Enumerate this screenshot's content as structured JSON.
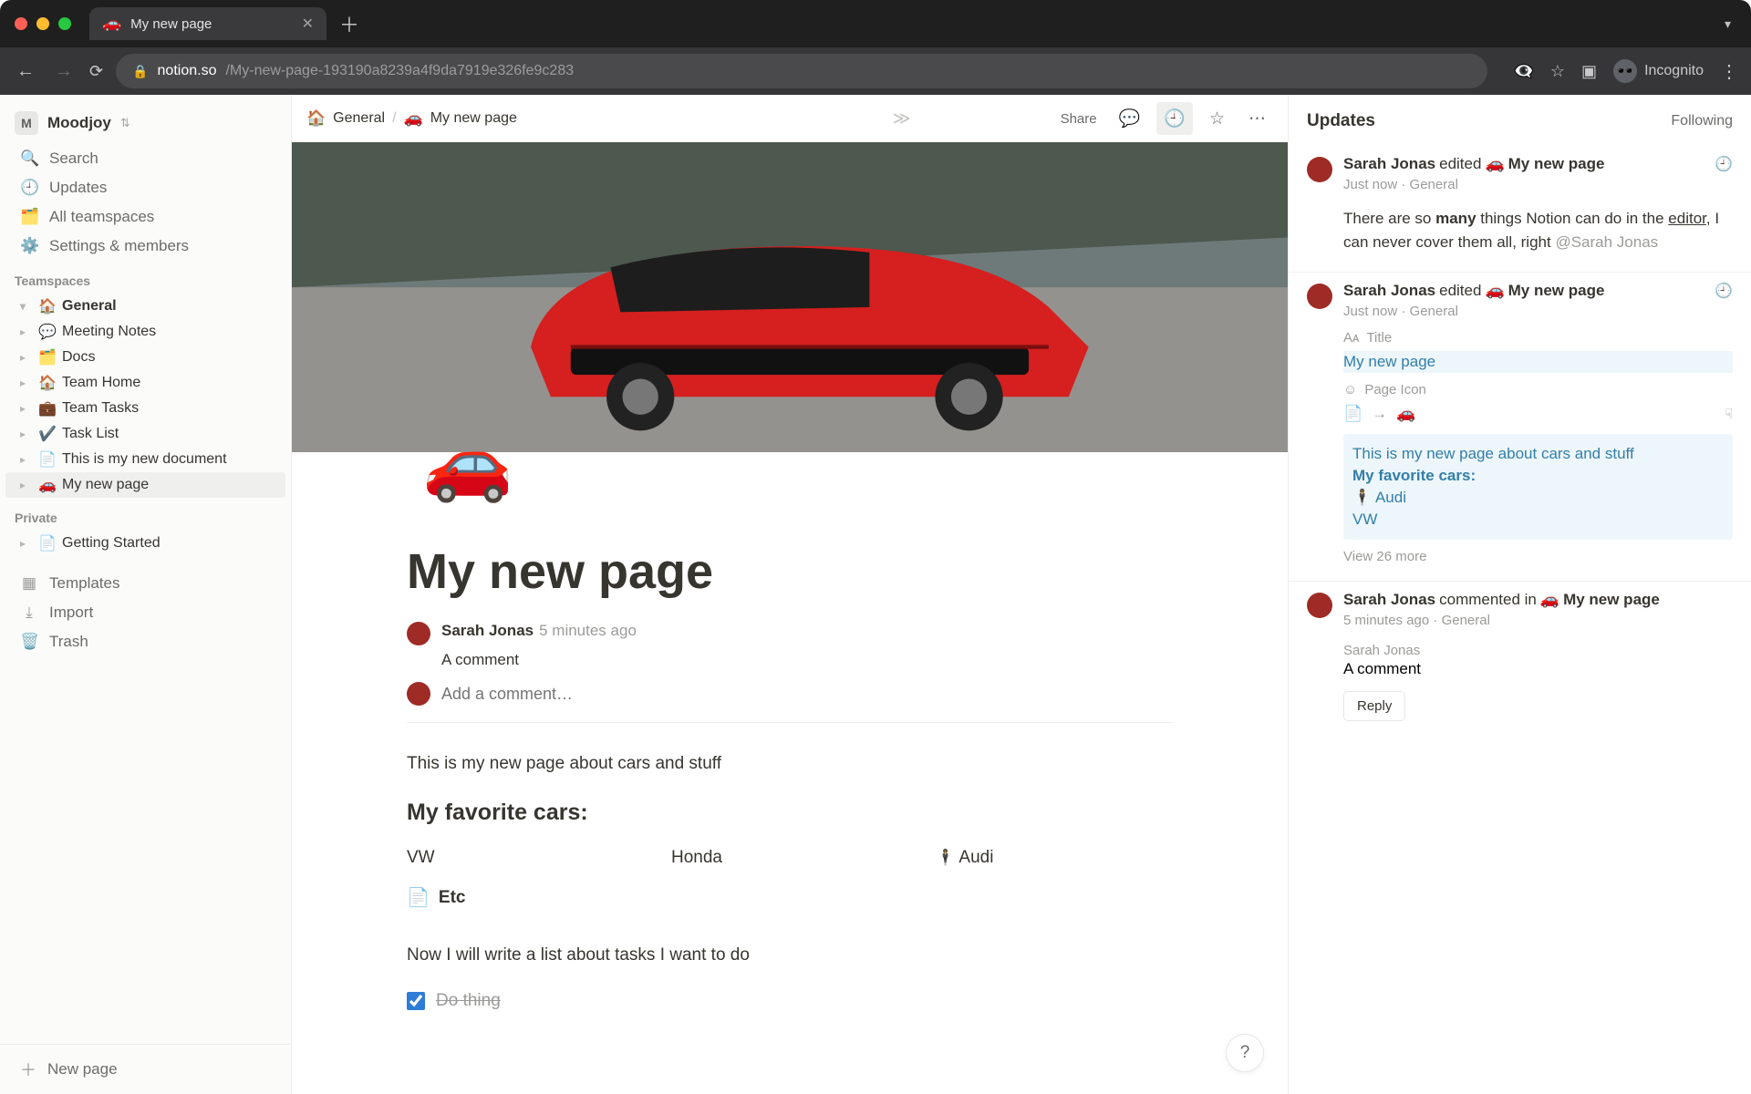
{
  "browser": {
    "tab_emoji": "🚗",
    "tab_title": "My new page",
    "url_host": "notion.so",
    "url_path": "/My-new-page-193190a8239a4f9da7919e326fe9c283",
    "incognito_label": "Incognito"
  },
  "workspace": {
    "initial": "M",
    "name": "Moodjoy"
  },
  "sidebar": {
    "search": "Search",
    "updates": "Updates",
    "all_teamspaces": "All teamspaces",
    "settings": "Settings & members",
    "section_teamspaces": "Teamspaces",
    "section_private": "Private",
    "teamspace_items": [
      {
        "icon": "🏠",
        "label": "General",
        "bold": true,
        "caret": "▾"
      },
      {
        "icon": "💬",
        "label": "Meeting Notes",
        "caret": "▸"
      },
      {
        "icon": "🗂️",
        "label": "Docs",
        "caret": "▸"
      },
      {
        "icon": "🏠",
        "label": "Team Home",
        "caret": "▸"
      },
      {
        "icon": "💼",
        "label": "Team Tasks",
        "caret": "▸"
      },
      {
        "icon": "✔️",
        "label": "Task List",
        "caret": "▸"
      },
      {
        "icon": "📄",
        "label": "This is my new document",
        "caret": "▸"
      },
      {
        "icon": "🚗",
        "label": "My new page",
        "caret": "▸",
        "active": true
      }
    ],
    "private_items": [
      {
        "icon": "📄",
        "label": "Getting Started",
        "caret": "▸"
      }
    ],
    "templates": "Templates",
    "import": "Import",
    "trash": "Trash",
    "new_page": "New page"
  },
  "breadcrumb": {
    "root_icon": "🏠",
    "root": "General",
    "page_icon": "🚗",
    "page": "My new page"
  },
  "topbar": {
    "share": "Share"
  },
  "page": {
    "emoji": "🚗",
    "title": "My new page",
    "comment": {
      "author": "Sarah Jonas",
      "time": "5 minutes ago",
      "body": "A comment"
    },
    "add_comment_placeholder": "Add a comment…",
    "intro": "This is my new page about cars and stuff",
    "heading": "My favorite cars:",
    "cols": [
      "VW",
      "Honda",
      "Audi"
    ],
    "col3_icon": "🕴️",
    "etc": "Etc",
    "tasks_intro": "Now I will write a list about tasks I want to do",
    "todo": {
      "checked": true,
      "label": "Do thing"
    }
  },
  "updates_panel": {
    "title": "Updates",
    "following": "Following",
    "entries": [
      {
        "author": "Sarah Jonas",
        "verb": "edited",
        "page_icon": "🚗",
        "page": "My new page",
        "time": "Just now",
        "space": "General",
        "body_parts": {
          "pre": "There are so ",
          "bold": "many",
          "mid": " things Notion can do in the ",
          "under": "editor",
          "post": ", I can never cover them all, right ",
          "mention": "@Sarah Jonas"
        },
        "has_bell": true
      },
      {
        "author": "Sarah Jonas",
        "verb": "edited",
        "page_icon": "🚗",
        "page": "My new page",
        "time": "Just now",
        "space": "General",
        "has_bell": true,
        "change": {
          "title_label": "Title",
          "title_value": "My new page",
          "icon_label": "Page Icon",
          "icon_from": "📄",
          "icon_arrow": "→",
          "icon_to": "🚗",
          "diff": [
            "This is my new page about cars and stuff",
            "My favorite cars:",
            "🕴️ Audi",
            "VW"
          ],
          "view_more": "View 26 more"
        }
      },
      {
        "author": "Sarah Jonas",
        "verb": "commented in",
        "page_icon": "🚗",
        "page": "My new page",
        "time": "5 minutes ago",
        "space": "General",
        "comment_author": "Sarah Jonas",
        "comment_body": "A comment",
        "reply": "Reply"
      }
    ]
  }
}
